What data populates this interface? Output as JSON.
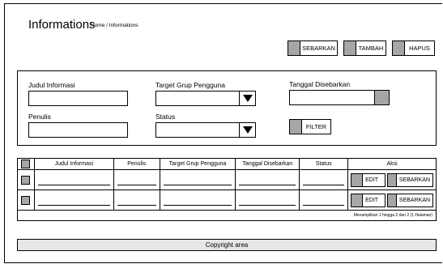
{
  "page": {
    "title": "Informations",
    "breadcrumb": "Home / Informations"
  },
  "toolbar": {
    "sebarkan": "SEBARKAN",
    "tambah": "TAMBAH",
    "hapus": "HAPUS"
  },
  "filters": {
    "judul_label": "Judul Informasi",
    "judul_value": "",
    "target_label": "Target Grup Pengguna",
    "target_value": "",
    "tanggal_label": "Tanggal Disebarkan",
    "tanggal_value": "",
    "penulis_label": "Penulis",
    "penulis_value": "",
    "status_label": "Status",
    "status_value": "",
    "filter_button": "FILTER"
  },
  "table": {
    "columns": [
      "",
      "Judul Informasi",
      "Penulis",
      "Target Grup Pengguna",
      "Tanggal Disebarkan",
      "Status",
      "Aksi"
    ],
    "rows": [
      {
        "edit": "EDIT",
        "sebarkan": "SEBARKAN"
      },
      {
        "edit": "EDIT",
        "sebarkan": "SEBARKAN"
      }
    ],
    "pagination": "Menampilkan 1 hingga 2 dari 2 (1 Halaman)"
  },
  "footer": {
    "text": "Copyright area"
  }
}
